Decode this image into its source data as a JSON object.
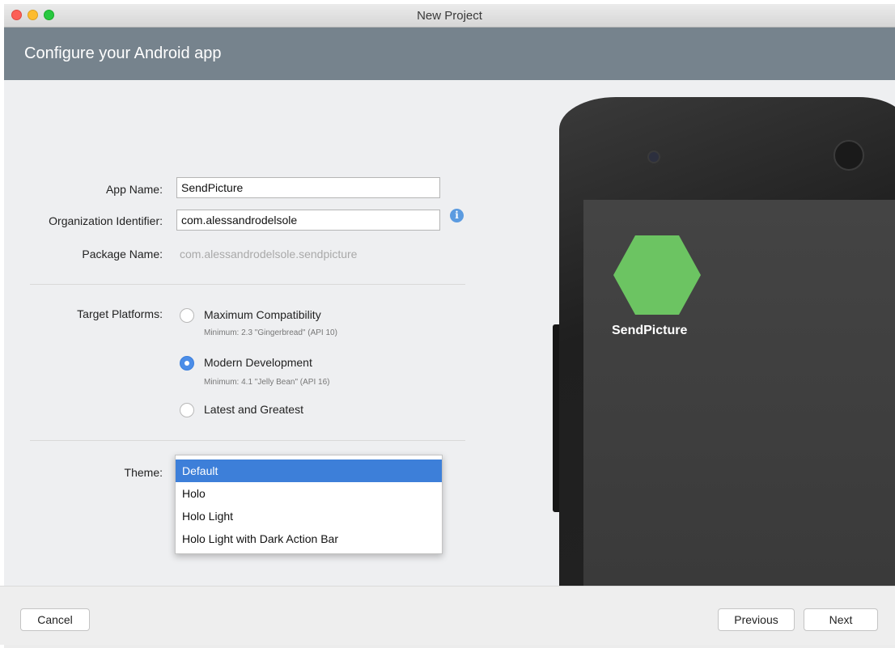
{
  "window": {
    "title": "New Project"
  },
  "header": {
    "title": "Configure your Android app"
  },
  "form": {
    "app_name_label": "App Name:",
    "app_name_value": "SendPicture",
    "org_label": "Organization Identifier:",
    "org_value": "com.alessandrodelsole",
    "info_icon_glyph": "i",
    "package_label": "Package Name:",
    "package_value": "com.alessandrodelsole.sendpicture",
    "platforms_label": "Target Platforms:",
    "platforms": [
      {
        "label": "Maximum Compatibility",
        "sub": "Minimum: 2.3 \"Gingerbread\" (API 10)",
        "selected": false
      },
      {
        "label": "Modern Development",
        "sub": "Minimum: 4.1 \"Jelly Bean\" (API 16)",
        "selected": true
      },
      {
        "label": "Latest and Greatest",
        "sub": "",
        "selected": false
      }
    ],
    "theme_label": "Theme:",
    "theme_options": [
      "Default",
      "Holo",
      "Holo Light",
      "Holo Light with Dark Action Bar"
    ],
    "theme_selected": "Default"
  },
  "preview": {
    "app_name": "SendPicture",
    "icon_color": "#6cc462"
  },
  "footer": {
    "cancel": "Cancel",
    "previous": "Previous",
    "next": "Next"
  },
  "colors": {
    "header_bg": "#76838d",
    "accent": "#3d7fd9"
  }
}
